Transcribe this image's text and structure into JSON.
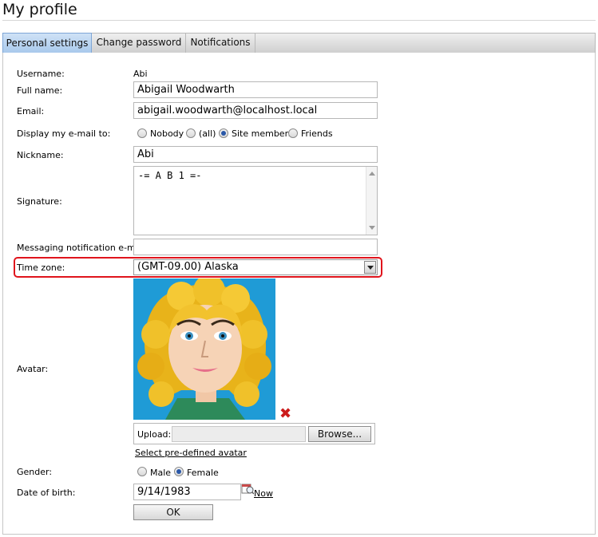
{
  "page": {
    "title": "My profile"
  },
  "tabs": [
    {
      "label": "Personal settings",
      "active": true
    },
    {
      "label": "Change password",
      "active": false
    },
    {
      "label": "Notifications",
      "active": false
    }
  ],
  "form": {
    "username_label": "Username:",
    "username_value": "Abi",
    "fullname_label": "Full name:",
    "fullname_value": "Abigail Woodwarth",
    "email_label": "Email:",
    "email_value": "abigail.woodwarth@localhost.local",
    "display_email_label": "Display my e-mail to:",
    "display_email_options": [
      {
        "label": "Nobody",
        "checked": false
      },
      {
        "label": "(all)",
        "checked": false
      },
      {
        "label": "Site members",
        "checked": true
      },
      {
        "label": "Friends",
        "checked": false
      }
    ],
    "nickname_label": "Nickname:",
    "nickname_value": "Abi",
    "signature_label": "Signature:",
    "signature_value": "-= A B 1 =-",
    "messaging_email_label": "Messaging notification e-mail:",
    "messaging_email_value": "",
    "timezone_label": "Time zone:",
    "timezone_value": "(GMT-09.00) Alaska",
    "avatar_label": "Avatar:",
    "upload_label": "Upload:",
    "browse_label": "Browse...",
    "predefined_avatar_link": "Select pre-defined avatar",
    "gender_label": "Gender:",
    "gender_options": [
      {
        "label": "Male",
        "checked": false
      },
      {
        "label": "Female",
        "checked": true
      }
    ],
    "dob_label": "Date of birth:",
    "dob_value": "9/14/1983",
    "now_link": "Now",
    "ok_label": "OK"
  },
  "colors": {
    "highlight": "#e0141c",
    "active_tab": "#a9c9ec",
    "avatar_bg": "#1f9bd6"
  }
}
